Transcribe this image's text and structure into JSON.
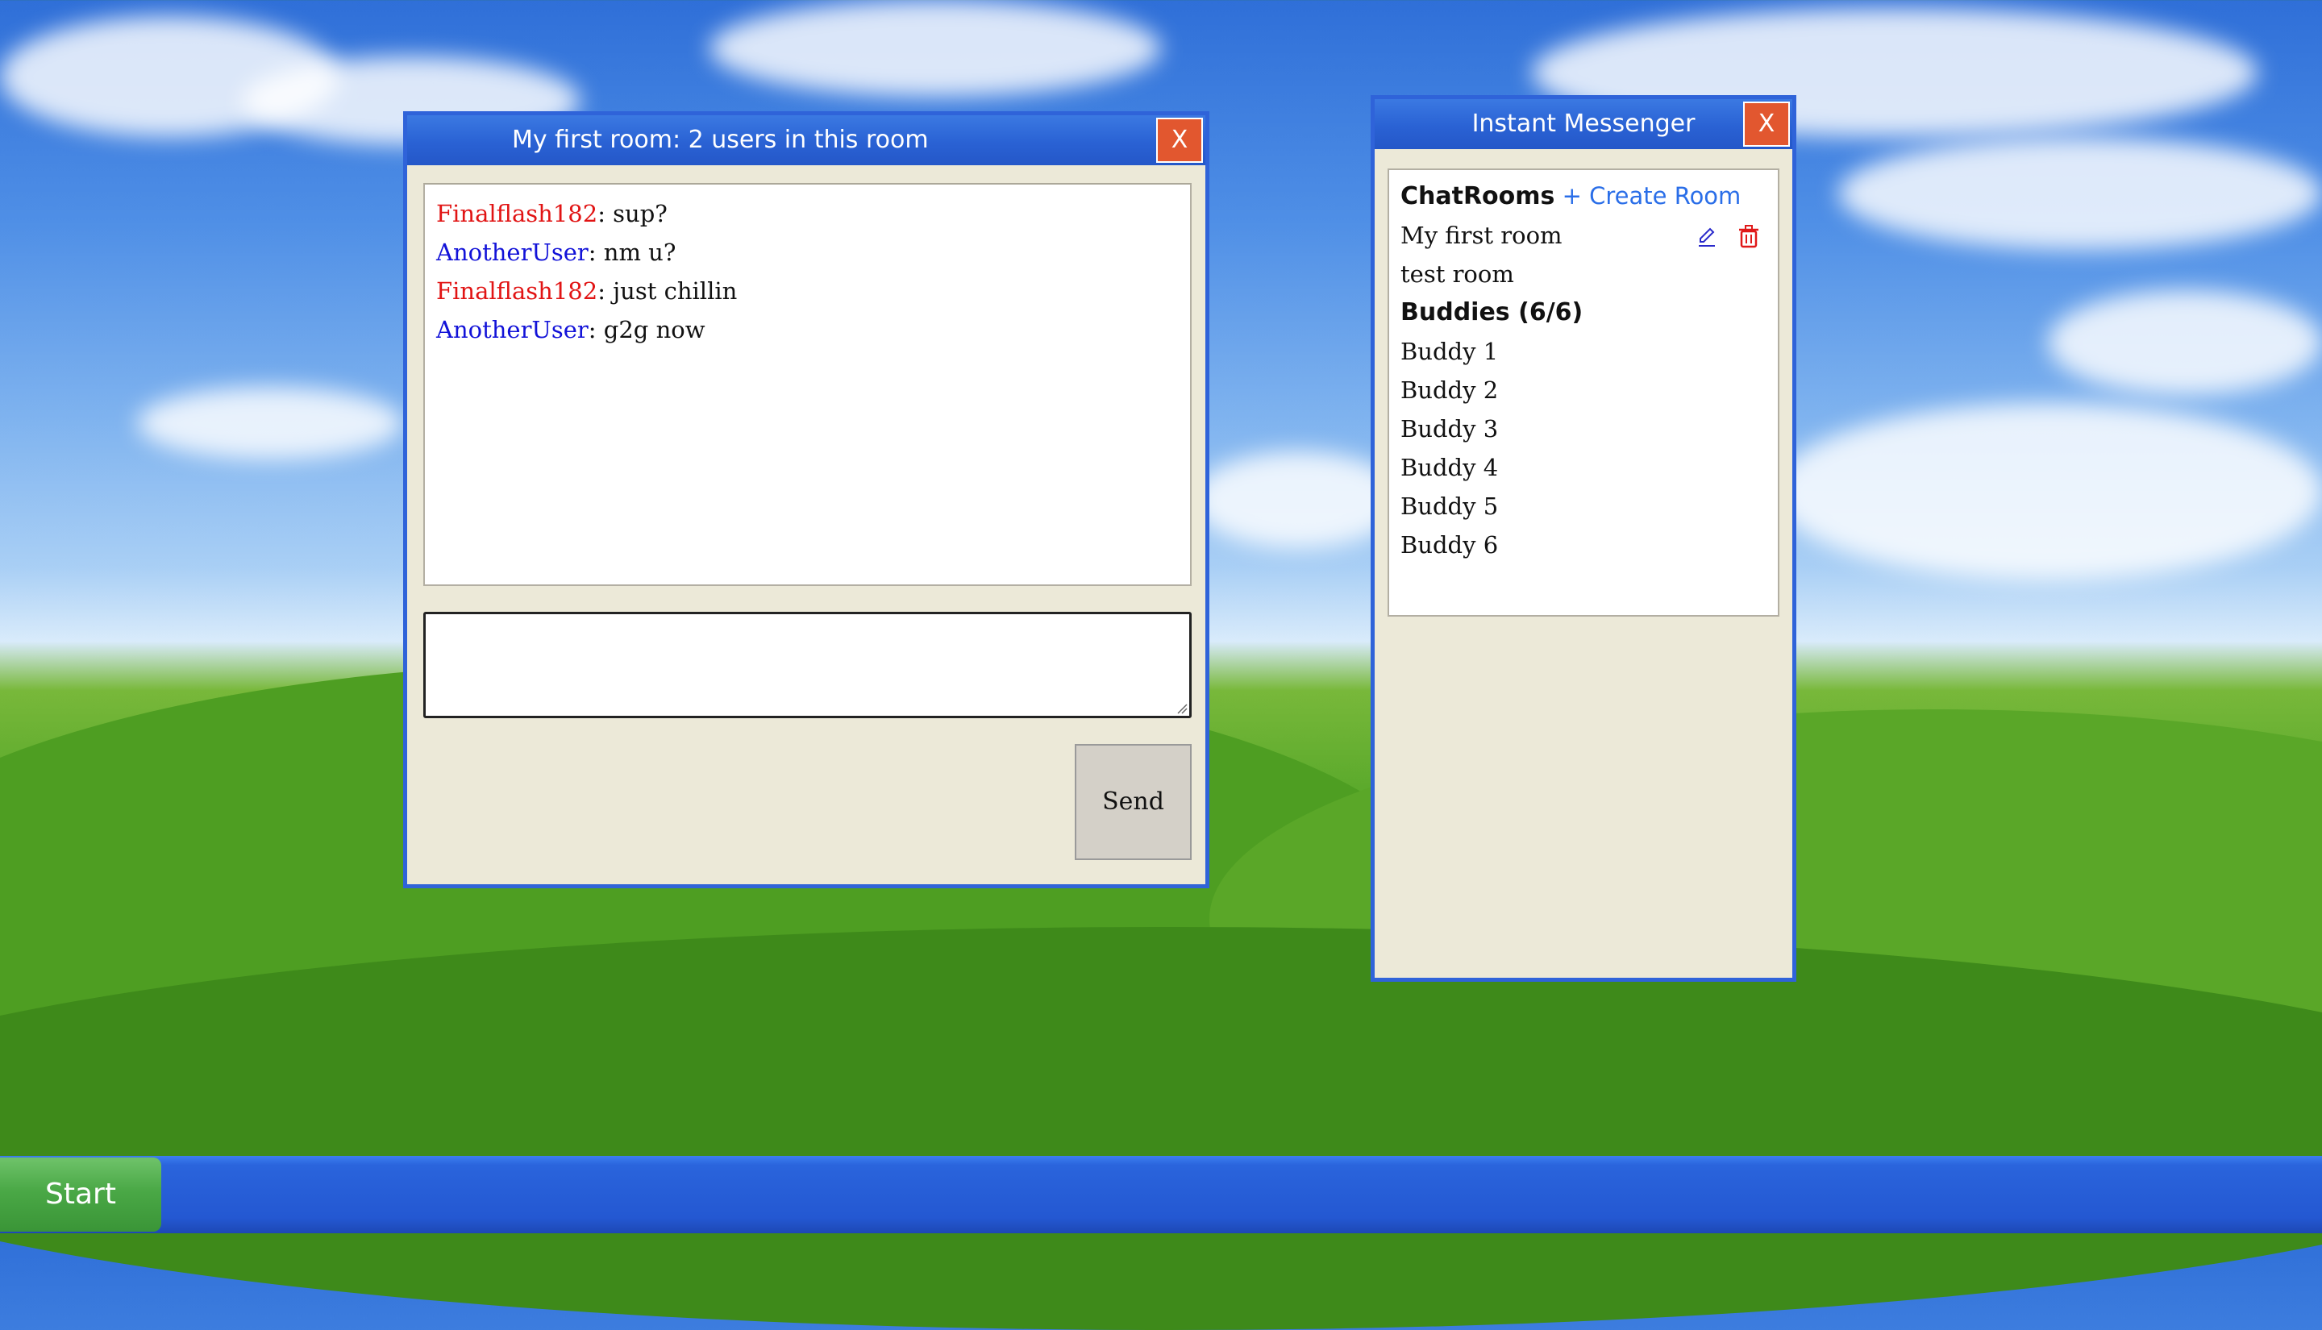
{
  "chat_window": {
    "title": "My first room: 2 users in this room",
    "close_label": "X",
    "messages": [
      {
        "user": "Finalflash182",
        "text": ": sup?",
        "color": "#e11414"
      },
      {
        "user": "AnotherUser",
        "text": ": nm u?",
        "color": "#1212d8"
      },
      {
        "user": "Finalflash182",
        "text": ": just chillin",
        "color": "#e11414"
      },
      {
        "user": "AnotherUser",
        "text": ": g2g now",
        "color": "#1212d8"
      }
    ],
    "input_value": "",
    "send_label": "Send"
  },
  "im_window": {
    "title": "Instant Messenger",
    "close_label": "X",
    "chatrooms_heading": "ChatRooms",
    "create_room_label": "+ Create Room",
    "rooms": [
      {
        "name": "My first room",
        "icons": [
          "edit-icon",
          "trash-icon"
        ]
      },
      {
        "name": "test room"
      }
    ],
    "buddies_heading": "Buddies (6/6)",
    "buddies": [
      "Buddy 1",
      "Buddy 2",
      "Buddy 3",
      "Buddy 4",
      "Buddy 5",
      "Buddy 6"
    ]
  },
  "taskbar": {
    "start_label": "Start"
  },
  "colors": {
    "window_border": "#2f63d9",
    "close_button": "#e2572f",
    "window_body": "#ece9d8",
    "link_blue": "#2a6ee8",
    "edit_icon": "#2a2acb",
    "trash_icon": "#e01818",
    "start_green": "#4aa846"
  }
}
